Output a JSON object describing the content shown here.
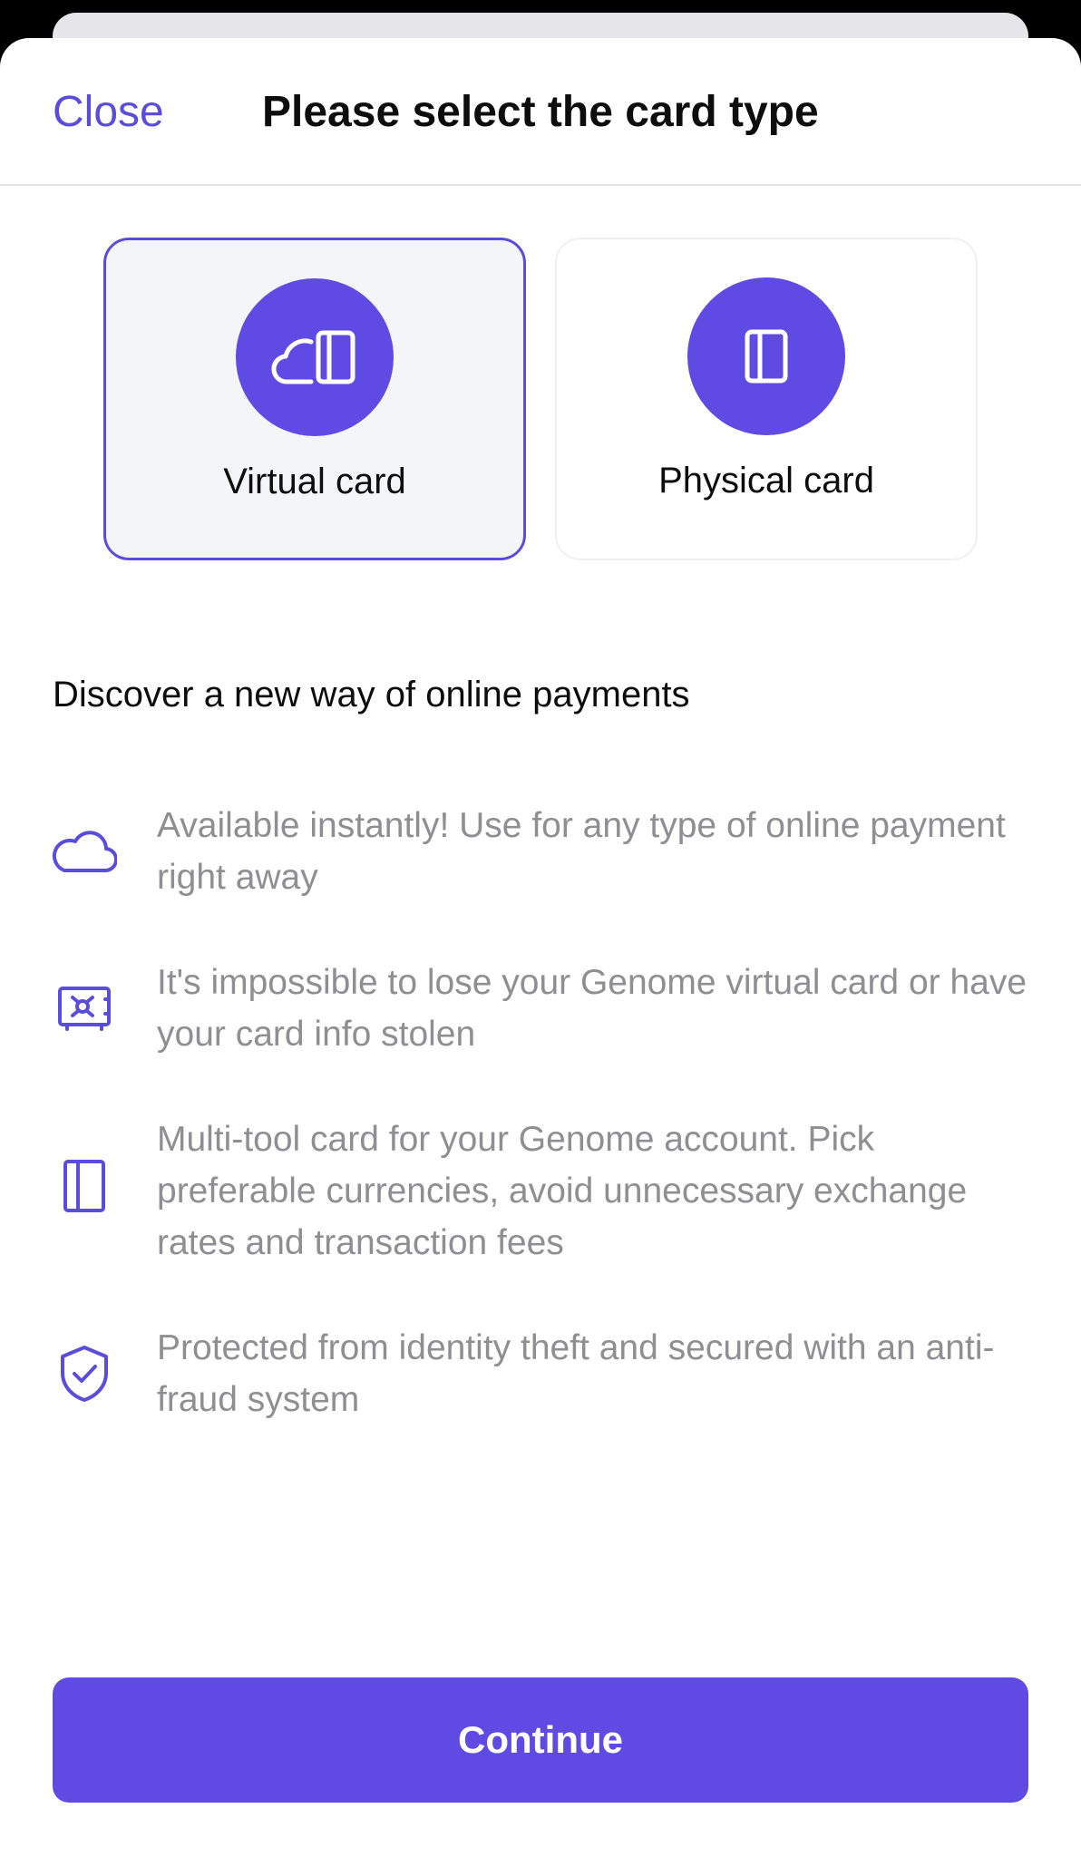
{
  "header": {
    "close_label": "Close",
    "title": "Please select the card type"
  },
  "card_types": [
    {
      "label": "Virtual card",
      "icon": "cloud-card-icon",
      "selected": true
    },
    {
      "label": "Physical card",
      "icon": "card-icon",
      "selected": false
    }
  ],
  "section_heading": "Discover a new way of online payments",
  "features": [
    {
      "icon": "cloud-icon",
      "text": "Available instantly! Use for any type of online payment right away"
    },
    {
      "icon": "safe-icon",
      "text": "It's impossible to lose your Genome virtual card  or have your card info stolen"
    },
    {
      "icon": "card-icon",
      "text": "Multi-tool card for your Genome account. Pick preferable currencies, avoid unnecessary exchange rates and transaction fees"
    },
    {
      "icon": "shield-check-icon",
      "text": "Protected from identity theft and secured with an anti-fraud system"
    }
  ],
  "continue_label": "Continue",
  "colors": {
    "accent": "#5f4be3",
    "link": "#5b4ddc",
    "muted_text": "#8e8e93",
    "selected_bg": "#f4f5f9"
  }
}
